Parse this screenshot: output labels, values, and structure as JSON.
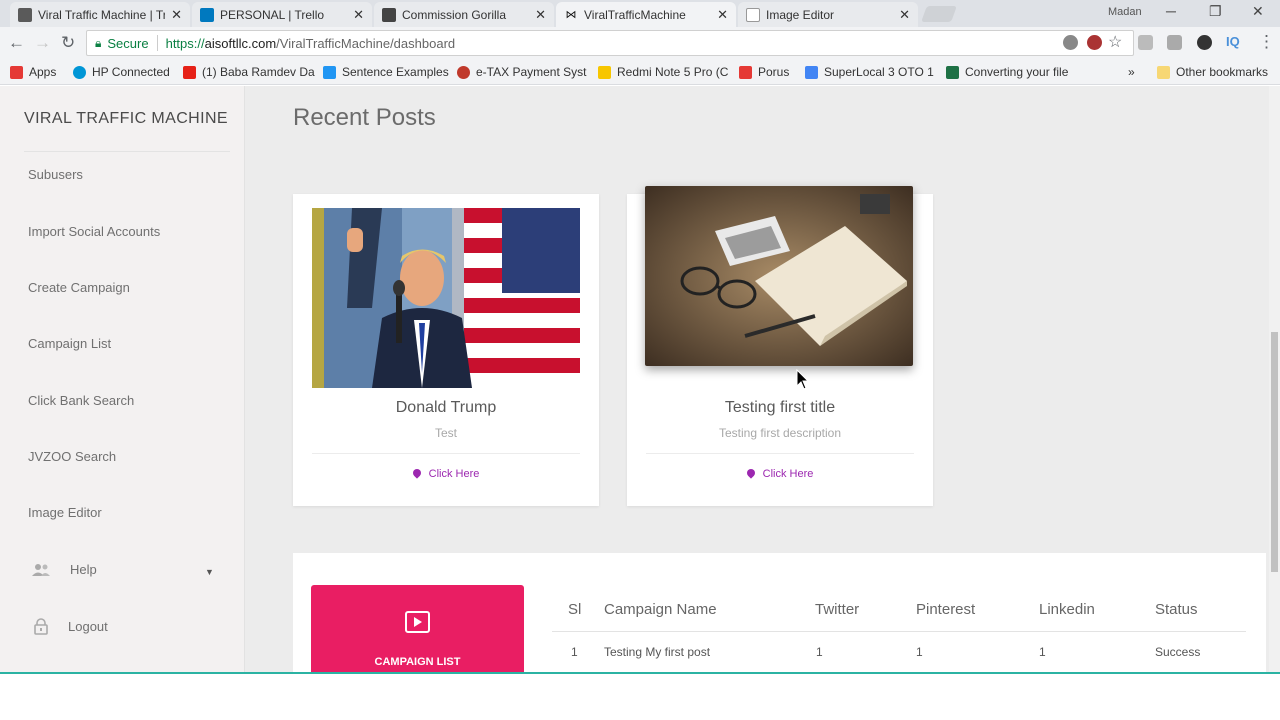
{
  "browser": {
    "tabs": [
      {
        "title": "Viral Traffic Machine | Tre",
        "color": "#5a5a5a",
        "active": false
      },
      {
        "title": "PERSONAL | Trello",
        "color": "#0079bf",
        "active": false
      },
      {
        "title": "Commission Gorilla",
        "color": "#444444",
        "active": false
      },
      {
        "title": "ViralTrafficMachine",
        "color": "#111111",
        "active": true
      },
      {
        "title": "Image Editor",
        "color": "#9e9e9e",
        "active": false
      }
    ],
    "user": "Madan",
    "security_label": "Secure",
    "url": {
      "scheme": "https://",
      "host": "aisoftllc.com",
      "path": "/ViralTrafficMachine/dashboard"
    },
    "bookmarks": [
      {
        "label": "Apps",
        "icon": "apps-grid-icon",
        "color": "#e53935"
      },
      {
        "label": "HP Connected",
        "icon": "hp-icon",
        "color": "#0096d6"
      },
      {
        "label": "(1) Baba Ramdev Da",
        "icon": "youtube-icon",
        "color": "#e62117"
      },
      {
        "label": "Sentence Examples",
        "icon": "bookmark-icon",
        "color": "#2196f3"
      },
      {
        "label": "e-TAX Payment Syst",
        "icon": "bookmark-icon",
        "color": "#c0392b"
      },
      {
        "label": "Redmi Note 5 Pro (C",
        "icon": "flipkart-icon",
        "color": "#f7c600"
      },
      {
        "label": "Porus",
        "icon": "bookmark-icon",
        "color": "#e53935"
      },
      {
        "label": "SuperLocal 3 OTO 1",
        "icon": "docs-icon",
        "color": "#4285f4"
      },
      {
        "label": "Converting your file",
        "icon": "excel-icon",
        "color": "#1e7145"
      }
    ],
    "overflow": "»",
    "other_bookmarks": "Other bookmarks"
  },
  "sidebar": {
    "brand": "VIRAL TRAFFIC MACHINE",
    "items": [
      {
        "label": "Subusers"
      },
      {
        "label": "Import Social Accounts"
      },
      {
        "label": "Create Campaign"
      },
      {
        "label": "Campaign List"
      },
      {
        "label": "Click Bank Search"
      },
      {
        "label": "JVZOO Search"
      },
      {
        "label": "Image Editor"
      }
    ],
    "help": "Help",
    "logout": "Logout"
  },
  "main": {
    "title": "Recent Posts",
    "posts": [
      {
        "title": "Donald Trump",
        "description": "Test",
        "link": "Click Here"
      },
      {
        "title": "Testing first title",
        "description": "Testing first description",
        "link": "Click Here"
      }
    ],
    "campaign_button": "CAMPAIGN LIST",
    "table": {
      "headers": [
        "Sl",
        "Campaign Name",
        "Twitter",
        "Pinterest",
        "Linkedin",
        "Status"
      ],
      "rows": [
        [
          "1",
          "Testing My first post",
          "1",
          "1",
          "1",
          "Success"
        ]
      ]
    }
  },
  "colors": {
    "accent": "#e91e63",
    "link": "#9c27b0",
    "secure": "#0b8043"
  }
}
